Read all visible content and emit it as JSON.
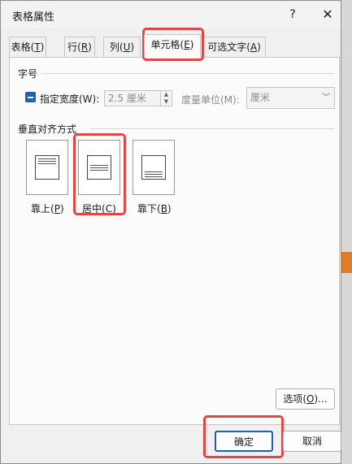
{
  "window": {
    "title": "表格属性",
    "help": "?",
    "close": "✕"
  },
  "tabs": [
    {
      "pre": "表格(",
      "key": "T",
      "post": ")"
    },
    {
      "pre": "行(",
      "key": "R",
      "post": ")"
    },
    {
      "pre": "列(",
      "key": "U",
      "post": ")"
    },
    {
      "pre": "单元格(",
      "key": "E",
      "post": ")"
    },
    {
      "pre": "可选文字(",
      "key": "A",
      "post": ")"
    }
  ],
  "size": {
    "heading": "字号",
    "width_label": "指定宽度(W):",
    "width_value": "2.5 厘米",
    "unit_label": "度量单位(M):",
    "unit_value": "厘米"
  },
  "valign": {
    "heading": "垂直对齐方式",
    "options": [
      {
        "pre": "靠上(",
        "key": "P",
        "post": ")"
      },
      {
        "pre": "居中(",
        "key": "C",
        "post": ")"
      },
      {
        "pre": "靠下(",
        "key": "B",
        "post": ")"
      }
    ]
  },
  "buttons": {
    "options": {
      "pre": "选项(",
      "key": "O",
      "post": ")..."
    },
    "ok": "确定",
    "cancel": "取消"
  },
  "colors": {
    "highlight": "#e04848",
    "checkbox": "#1c62b8",
    "ok_border": "#1f5fae"
  }
}
